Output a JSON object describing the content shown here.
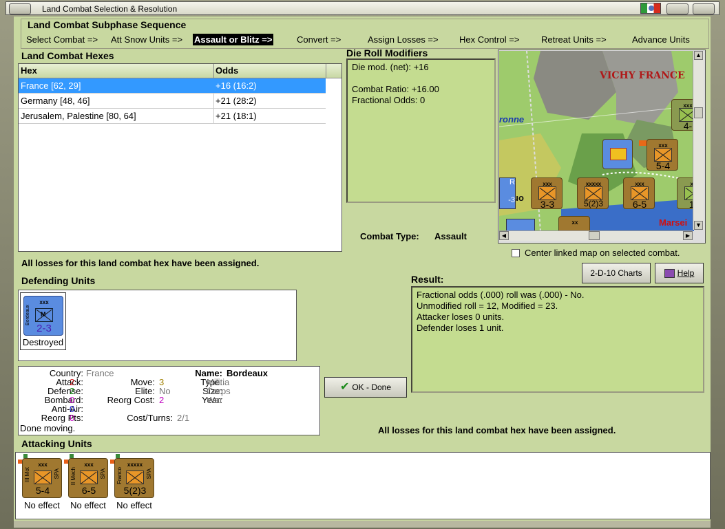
{
  "window": {
    "title": "Land Combat Selection & Resolution"
  },
  "subphase": {
    "heading": "Land Combat Subphase Sequence",
    "steps": [
      "Select Combat =>",
      "Att Snow Units =>",
      "Assault or Blitz =>",
      "Convert =>",
      "Assign Losses =>",
      "Hex Control =>",
      "Retreat Units =>",
      "Advance Units"
    ]
  },
  "hexes": {
    "heading": "Land Combat Hexes",
    "columns": [
      "Hex",
      "Odds"
    ],
    "rows": [
      {
        "hex": "France [62, 29]",
        "odds": "+16 (16:2)"
      },
      {
        "hex": "Germany [48, 46]",
        "odds": "+21 (28:2)"
      },
      {
        "hex": "Jerusalem, Palestine [80, 64]",
        "odds": "+21 (18:1)"
      }
    ]
  },
  "die_roll": {
    "heading": "Die Roll Modifiers",
    "lines": [
      "Die mod. (net): +16",
      "",
      "Combat Ratio: +16.00",
      "Fractional Odds: 0"
    ]
  },
  "map": {
    "labels": {
      "vichy": "VICHY FRANCE",
      "ronne": "ronne",
      "marsei": "Marsei",
      "uo": "uo"
    },
    "counters": [
      {
        "size": "xxx",
        "val": "5-4"
      },
      {
        "size": "xxx",
        "val": "3-3"
      },
      {
        "size": "xxxxx",
        "val": "5(2)3"
      },
      {
        "size": "xxx",
        "val": "6-5"
      },
      {
        "size": "xx",
        "val": "1-"
      },
      {
        "size": "xxx",
        "val": "4-"
      },
      {
        "size": "xx",
        "val": ""
      }
    ],
    "partial": {
      "left": "-3",
      "top": "R"
    },
    "center_checkbox": "Center linked map on selected combat."
  },
  "combat_type": {
    "label": "Combat Type:",
    "value": "Assault"
  },
  "losses_msg": "All losses for this land combat hex have been assigned.",
  "defending": {
    "heading": "Defending Units",
    "units": [
      {
        "size": "xxx",
        "name": "Bordeaux",
        "val": "2-3",
        "status": "Destroyed"
      }
    ]
  },
  "unit_info": {
    "country_label": "Country:",
    "country": "France",
    "attack_label": "Attack:",
    "attack": "2",
    "defense_label": "Defense:",
    "defense": "2",
    "bombard_label": "Bombard:",
    "bombard": "0",
    "antiair_label": "Anti-Air:",
    "antiair": "0",
    "reorgpts_label": "Reorg Pts:",
    "reorgpts": "0",
    "move_label": "Move:",
    "move": "3",
    "elite_label": "Elite:",
    "elite": "No",
    "reorgcost_label": "Reorg Cost:",
    "reorgcost": "2",
    "costturns_label": "Cost/Turns:",
    "costturns": "2/1",
    "name_label": "Name:",
    "name": "Bordeaux",
    "type_label": "Type:",
    "type": "Militia",
    "size_label": "Size:",
    "size": "Corps",
    "year_label": "Year:",
    "year": "War",
    "done": "Done moving."
  },
  "buttons": {
    "charts": "2-D-10 Charts",
    "help": "Help",
    "ok": "OK - Done"
  },
  "result": {
    "heading": "Result:",
    "lines": [
      "Fractional odds (.000) roll was (.000)  - No.",
      "Unmodified roll = 12, Modified = 23.",
      "Attacker loses 0 units.",
      "Defender loses 1 unit."
    ]
  },
  "attacking": {
    "heading": "Attacking Units",
    "units": [
      {
        "size": "xxx",
        "name": "III Mot",
        "nation": "SPA",
        "val": "5-4",
        "status": "No effect"
      },
      {
        "size": "xxx",
        "name": "II Mech",
        "nation": "SPA",
        "val": "6-5",
        "status": "No effect"
      },
      {
        "size": "xxxxx",
        "name": "Franco",
        "nation": "SPA",
        "val": "5(2)3",
        "status": "No effect"
      }
    ]
  },
  "colors": {
    "panel": "#c8d8a0",
    "selected_row": "#3399ff",
    "counter_brown": "#a07830",
    "defender_blue": "#5a8ce0"
  }
}
